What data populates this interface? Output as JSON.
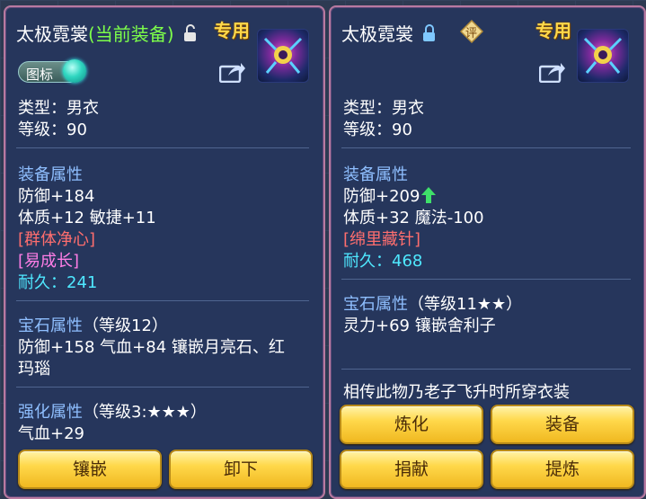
{
  "left": {
    "title": "太极霓裳",
    "title_status": "(当前装备)",
    "special": "专用",
    "toggle_label": "图标",
    "type_line": "类型：男衣",
    "level_line": "等级：90",
    "equip_header": "装备属性",
    "defense": "防御+184",
    "stats": "体质+12 敏捷+11",
    "effect1": "[群体净心]",
    "effect2": "[易成长]",
    "durability_label": "耐久：",
    "durability_value": "241",
    "gem_header": "宝石属性",
    "gem_level": "（等级12）",
    "gem_line1": "防御+158 气血+84 镶嵌月亮石、红",
    "gem_line2": "玛瑙",
    "enhance_header": "强化属性",
    "enhance_level": "（等级3:★★★）",
    "enhance_line": "气血+29",
    "btn_inlay": "镶嵌",
    "btn_unequip": "卸下"
  },
  "right": {
    "title": "太极霓裳",
    "special": "专用",
    "appraise_label": "评",
    "type_line": "类型：男衣",
    "level_line": "等级：90",
    "equip_header": "装备属性",
    "defense": "防御+209",
    "stats": "体质+32 魔法-100",
    "effect1": "[绵里藏针]",
    "durability_label": "耐久：",
    "durability_value": "468",
    "gem_header": "宝石属性",
    "gem_level": "（等级11★★）",
    "gem_line1": "灵力+69 镶嵌舍利子",
    "description": "相传此物乃老子飞升时所穿衣装",
    "btn_refine": "炼化",
    "btn_equip": "装备",
    "btn_donate": "捐献",
    "btn_extract": "提炼"
  },
  "colors": {
    "title": "#ffffff",
    "current_equipped": "#7dff4a",
    "special": "#ffd84a",
    "section_header": "#8fbfff",
    "effect_red": "#ff6e6e",
    "effect_pink": "#ff7ee6",
    "durability": "#4fe8ff",
    "increase_arrow": "#3fe06a",
    "button_gold": "#ffd84a"
  },
  "icons": [
    "lock-open-icon",
    "lock-closed-icon",
    "share-icon",
    "equipment-emblem-icon",
    "appraise-icon",
    "up-arrow-icon"
  ]
}
